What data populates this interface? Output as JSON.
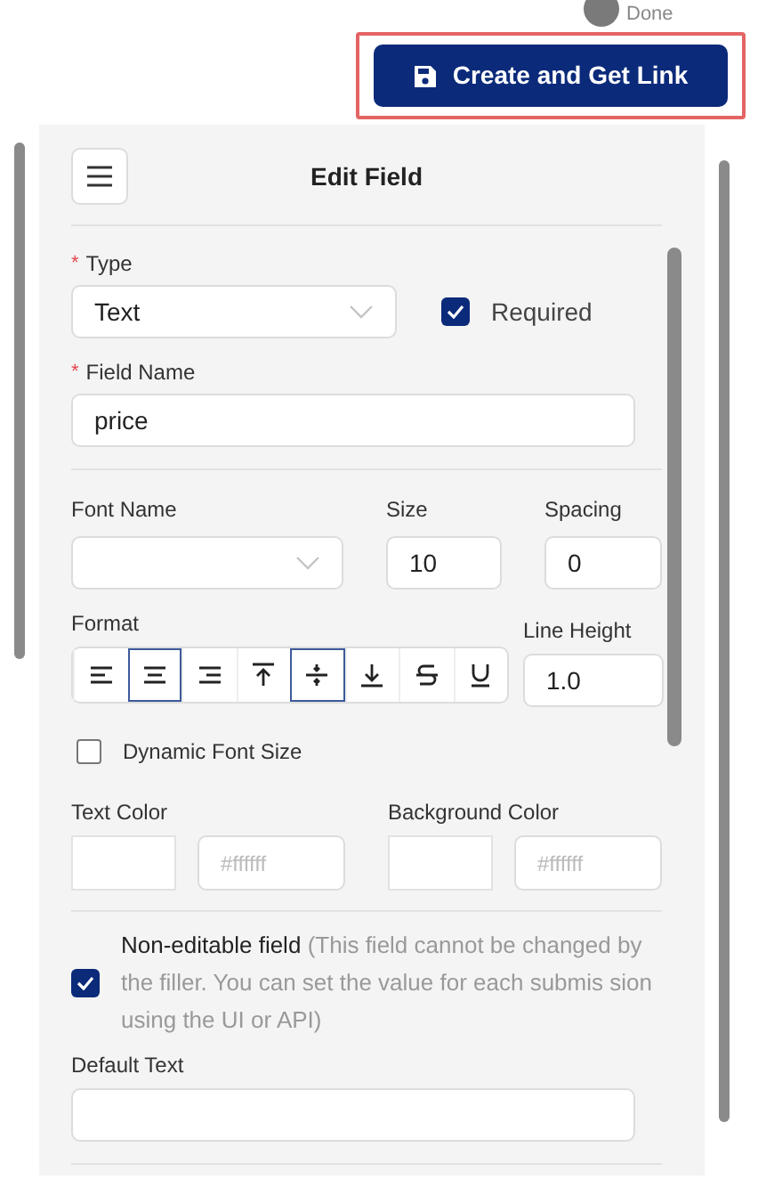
{
  "top_bar": {
    "step_label": "Done",
    "primary_button": "Create and Get Link"
  },
  "panel": {
    "title": "Edit Field",
    "type": {
      "label": "Type",
      "required_mark": "*",
      "value": "Text"
    },
    "required": {
      "label": "Required",
      "checked": true
    },
    "field_name": {
      "label": "Field Name",
      "required_mark": "*",
      "value": "price"
    },
    "font_name": {
      "label": "Font Name"
    },
    "size": {
      "label": "Size",
      "value": "10"
    },
    "spacing": {
      "label": "Spacing",
      "value": "0"
    },
    "format": {
      "label": "Format",
      "buttons": [
        {
          "kind": "align-left",
          "selected": false
        },
        {
          "kind": "align-center",
          "selected": true
        },
        {
          "kind": "align-right",
          "selected": false
        },
        {
          "kind": "align-top",
          "selected": false
        },
        {
          "kind": "align-middle",
          "selected": true
        },
        {
          "kind": "align-bottom",
          "selected": false
        },
        {
          "kind": "strikethrough",
          "selected": false
        },
        {
          "kind": "underline",
          "selected": false
        }
      ]
    },
    "line_height": {
      "label": "Line Height",
      "value": "1.0"
    },
    "dynamic_font_size": {
      "label": "Dynamic Font Size",
      "checked": false
    },
    "text_color": {
      "label": "Text Color",
      "placeholder": "#ffffff"
    },
    "background_color": {
      "label": "Background Color",
      "placeholder": "#ffffff"
    },
    "non_editable": {
      "label": "Non-editable field",
      "note": "(This field cannot be changed by the filler. You can set the value for each submis sion using the UI or API)",
      "checked": true
    },
    "default_text": {
      "label": "Default Text"
    }
  }
}
